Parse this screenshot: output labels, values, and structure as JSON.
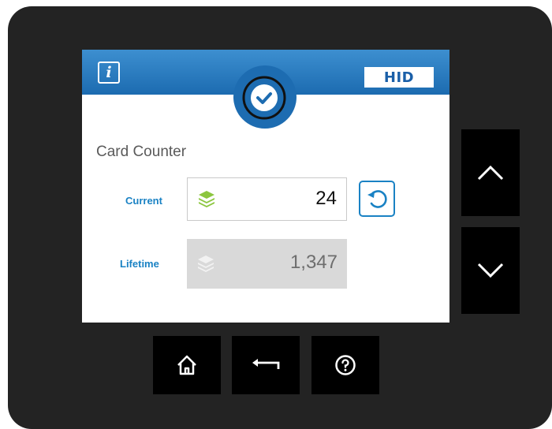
{
  "header": {
    "info_icon": "info-icon",
    "brand_logo": "HID",
    "status_icon": "check-circle-icon"
  },
  "card_counter": {
    "title": "Card Counter",
    "current": {
      "label": "Current",
      "value": "24",
      "icon": "layers-icon"
    },
    "lifetime": {
      "label": "Lifetime",
      "value": "1,347",
      "icon": "layers-icon"
    },
    "reset_icon": "reset-icon"
  },
  "side_buttons": [
    "up-arrow-icon",
    "down-arrow-icon"
  ],
  "bottom_buttons": [
    "home-icon",
    "back-icon",
    "help-icon"
  ],
  "colors": {
    "bezel": "#232323",
    "header_blue": "#1d6cb1",
    "label_blue": "#1a82c4",
    "layers_green": "#8cc63f",
    "lifetime_bg": "#d9d9d9"
  }
}
